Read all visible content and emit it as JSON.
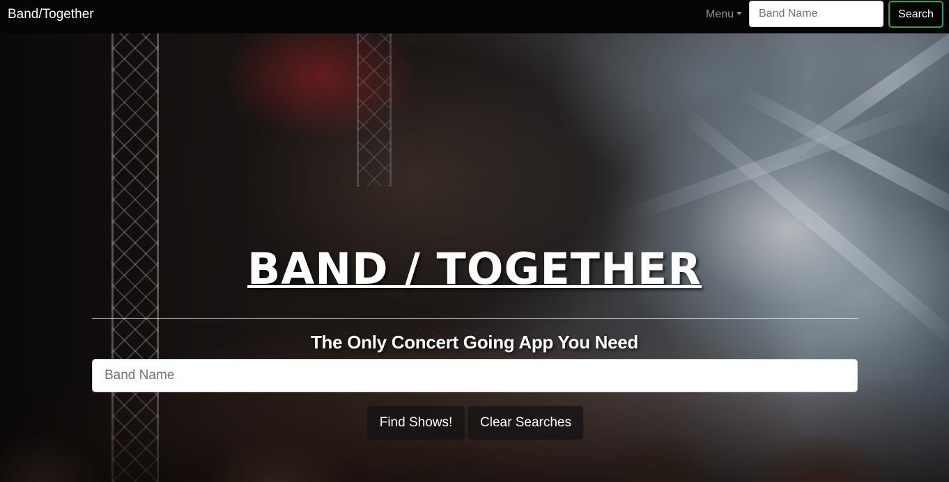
{
  "navbar": {
    "brand": "Band/Together",
    "menu_label": "Menu",
    "search_placeholder": "Band Name",
    "search_button": "Search"
  },
  "hero": {
    "title": "BAND / TOGETHER",
    "subtitle": "The Only Concert Going App You Need",
    "search_placeholder": "Band Name",
    "find_button": "Find Shows!",
    "clear_button": "Clear Searches"
  },
  "colors": {
    "navbar_bg": "#050505",
    "search_button_border": "#28a745",
    "text": "#ffffff"
  }
}
